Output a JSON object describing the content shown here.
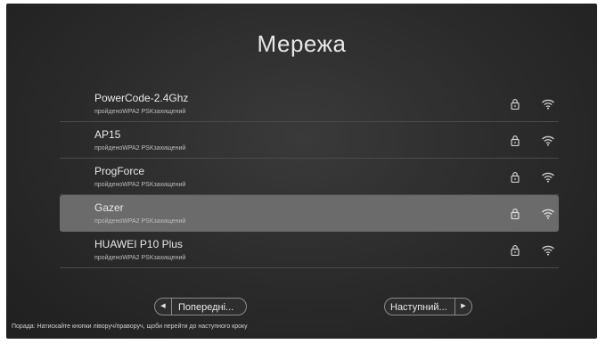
{
  "page": {
    "title": "Мережа"
  },
  "networks": [
    {
      "name": "PowerCode-2.4Ghz",
      "status": "пройденоWPA2 PSKзахищений",
      "lock_icon": "lock-icon",
      "signal_icon": "wifi-signal-icon"
    },
    {
      "name": "AP15",
      "status": "пройденоWPA2 PSKзахищений",
      "lock_icon": "lock-icon",
      "signal_icon": "wifi-signal-icon"
    },
    {
      "name": "ProgForce",
      "status": "пройденоWPA2 PSKзахищений",
      "lock_icon": "lock-icon",
      "signal_icon": "wifi-signal-icon"
    },
    {
      "name": "Gazer",
      "status": "пройденоWPA2 PSKзахищений",
      "lock_icon": "lock-icon",
      "signal_icon": "wifi-signal-icon",
      "selected": true
    },
    {
      "name": "HUAWEI P10 Plus",
      "status": "пройденоWPA2 PSKзахищений",
      "lock_icon": "lock-icon",
      "signal_icon": "wifi-signal-icon"
    }
  ],
  "nav": {
    "prev_label": "Попередні...",
    "next_label": "Наступний...",
    "prev_icon": "chevron-left-icon",
    "next_icon": "chevron-right-icon"
  },
  "hint": "Порада: Натискайте кнопки ліворуч/праворуч, щоби перейти до наступного кроку",
  "colors": {
    "background": "#2a2a2a",
    "selected_row": "#6b6b6b",
    "text": "#e8e8e8"
  }
}
